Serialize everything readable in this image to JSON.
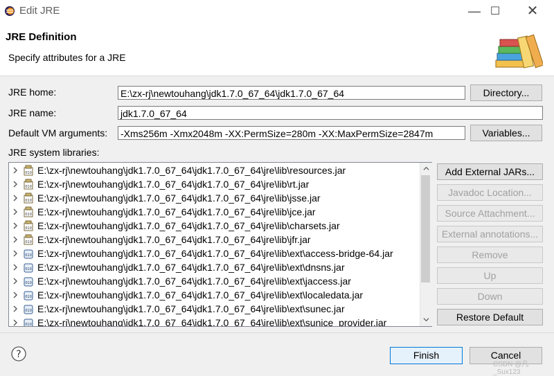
{
  "window": {
    "title": "Edit JRE",
    "controls": [
      "minimize-icon",
      "maximize-icon",
      "close-icon"
    ]
  },
  "header": {
    "title": "JRE Definition",
    "subtitle": "Specify attributes for a JRE",
    "icon": "books-icon"
  },
  "form": {
    "jre_home_label": "JRE home:",
    "jre_home_value": "E:\\zx-rj\\newtouhang\\jdk1.7.0_67_64\\jdk1.7.0_67_64",
    "directory_button": "Directory...",
    "jre_name_label": "JRE name:",
    "jre_name_value": "jdk1.7.0_67_64",
    "vm_args_label": "Default VM arguments:",
    "vm_args_value": "-Xms256m -Xmx2048m  -XX:PermSize=280m  -XX:MaxPermSize=2847m",
    "variables_button": "Variables...",
    "libraries_label": "JRE system libraries:"
  },
  "libraries": [
    {
      "path": "E:\\zx-rj\\newtouhang\\jdk1.7.0_67_64\\jdk1.7.0_67_64\\jre\\lib\\resources.jar",
      "icon": "jar-icon"
    },
    {
      "path": "E:\\zx-rj\\newtouhang\\jdk1.7.0_67_64\\jdk1.7.0_67_64\\jre\\lib\\rt.jar",
      "icon": "jar-icon"
    },
    {
      "path": "E:\\zx-rj\\newtouhang\\jdk1.7.0_67_64\\jdk1.7.0_67_64\\jre\\lib\\jsse.jar",
      "icon": "jar-icon"
    },
    {
      "path": "E:\\zx-rj\\newtouhang\\jdk1.7.0_67_64\\jdk1.7.0_67_64\\jre\\lib\\jce.jar",
      "icon": "jar-icon"
    },
    {
      "path": "E:\\zx-rj\\newtouhang\\jdk1.7.0_67_64\\jdk1.7.0_67_64\\jre\\lib\\charsets.jar",
      "icon": "jar-icon"
    },
    {
      "path": "E:\\zx-rj\\newtouhang\\jdk1.7.0_67_64\\jdk1.7.0_67_64\\jre\\lib\\jfr.jar",
      "icon": "jar-icon"
    },
    {
      "path": "E:\\zx-rj\\newtouhang\\jdk1.7.0_67_64\\jdk1.7.0_67_64\\jre\\lib\\ext\\access-bridge-64.jar",
      "icon": "ext-jar-icon"
    },
    {
      "path": "E:\\zx-rj\\newtouhang\\jdk1.7.0_67_64\\jdk1.7.0_67_64\\jre\\lib\\ext\\dnsns.jar",
      "icon": "ext-jar-icon"
    },
    {
      "path": "E:\\zx-rj\\newtouhang\\jdk1.7.0_67_64\\jdk1.7.0_67_64\\jre\\lib\\ext\\jaccess.jar",
      "icon": "ext-jar-icon"
    },
    {
      "path": "E:\\zx-rj\\newtouhang\\jdk1.7.0_67_64\\jdk1.7.0_67_64\\jre\\lib\\ext\\localedata.jar",
      "icon": "ext-jar-icon"
    },
    {
      "path": "E:\\zx-rj\\newtouhang\\jdk1.7.0_67_64\\jdk1.7.0_67_64\\jre\\lib\\ext\\sunec.jar",
      "icon": "ext-jar-icon"
    },
    {
      "path": "E:\\zx-rj\\newtouhang\\jdk1.7.0_67_64\\jdk1.7.0_67_64\\jre\\lib\\ext\\sunjce_provider.jar",
      "icon": "ext-jar-icon"
    }
  ],
  "side_buttons": {
    "add_external_jars": "Add External JARs...",
    "javadoc_location": "Javadoc Location...",
    "source_attachment": "Source Attachment...",
    "external_annotations": "External annotations...",
    "remove": "Remove",
    "up": "Up",
    "down": "Down",
    "restore_default": "Restore Default"
  },
  "footer": {
    "help_icon": "help-icon",
    "finish": "Finish",
    "cancel": "Cancel"
  },
  "watermark": "CSDN @凡_Sux123",
  "colors": {
    "dialog_bg": "#f0f0f0",
    "accent": "#0078d7"
  }
}
